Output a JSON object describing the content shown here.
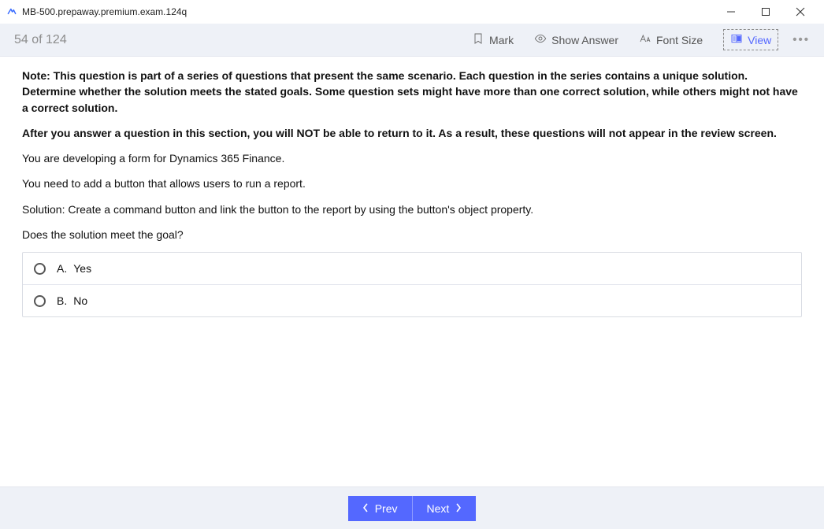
{
  "window": {
    "title": "MB-500.prepaway.premium.exam.124q"
  },
  "toolbar": {
    "progress": "54 of 124",
    "mark": "Mark",
    "show_answer": "Show Answer",
    "font_size": "Font Size",
    "view": "View",
    "more": "•••"
  },
  "question": {
    "note": "Note: This question is part of a series of questions that present the same scenario. Each question in the series contains a unique solution. Determine whether the solution meets the stated goals. Some question sets might have more than one correct solution, while others might not have a correct solution.",
    "warn": "After you answer a question in this section, you will NOT be able to return to it. As a result, these questions will not appear in the review screen.",
    "p1": "You are developing a form for Dynamics 365 Finance.",
    "p2": "You need to add a button that allows users to run a report.",
    "p3": "Solution: Create a command button and link the button to the report by using the button's object property.",
    "p4": "Does the solution meet the goal?",
    "options": [
      {
        "letter": "A.",
        "text": "Yes"
      },
      {
        "letter": "B.",
        "text": "No"
      }
    ]
  },
  "nav": {
    "prev": "Prev",
    "next": "Next"
  }
}
